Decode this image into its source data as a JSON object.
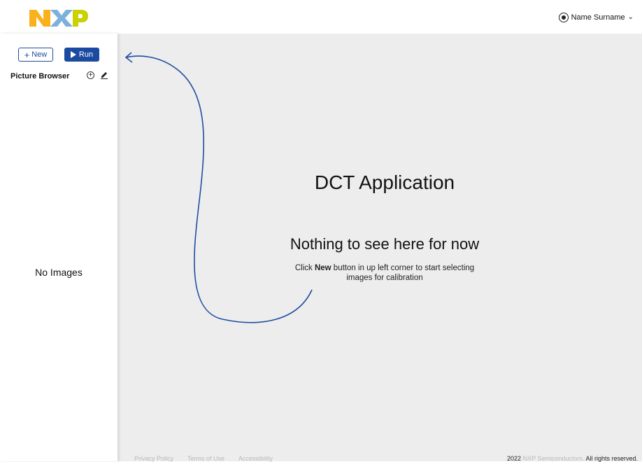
{
  "header": {
    "logo_text": "NXP",
    "user_name": "Name Surname",
    "icons": {
      "avatar": "user-avatar-icon",
      "dropdown": "chevron-down-icon"
    }
  },
  "toolbar": {
    "new_label": "New",
    "run_label": "Run",
    "icons": {
      "new": "plus-icon",
      "run": "play-icon"
    }
  },
  "sidebar": {
    "title": "Picture Browser",
    "empty_text": "No Images",
    "icons": {
      "add": "add-circle-icon",
      "edit": "pencil-icon"
    }
  },
  "main": {
    "title": "DCT Application",
    "empty_heading": "Nothing to see here for now",
    "hint_prefix": "Click ",
    "hint_bold": "New",
    "hint_suffix": " button in up left corner to start selecting images for calibration"
  },
  "footer": {
    "links": [
      "Privacy Policy",
      "Terms of Use",
      "Accessibility"
    ],
    "year": "2022",
    "company": "NXP Semiconductors.",
    "rights": "All rights reserved."
  },
  "colors": {
    "accent": "#1c4aa0",
    "main_bg": "#ededed",
    "logo_orange": "#f9b21b",
    "logo_blue": "#7bb1db",
    "logo_green": "#c9d200"
  }
}
